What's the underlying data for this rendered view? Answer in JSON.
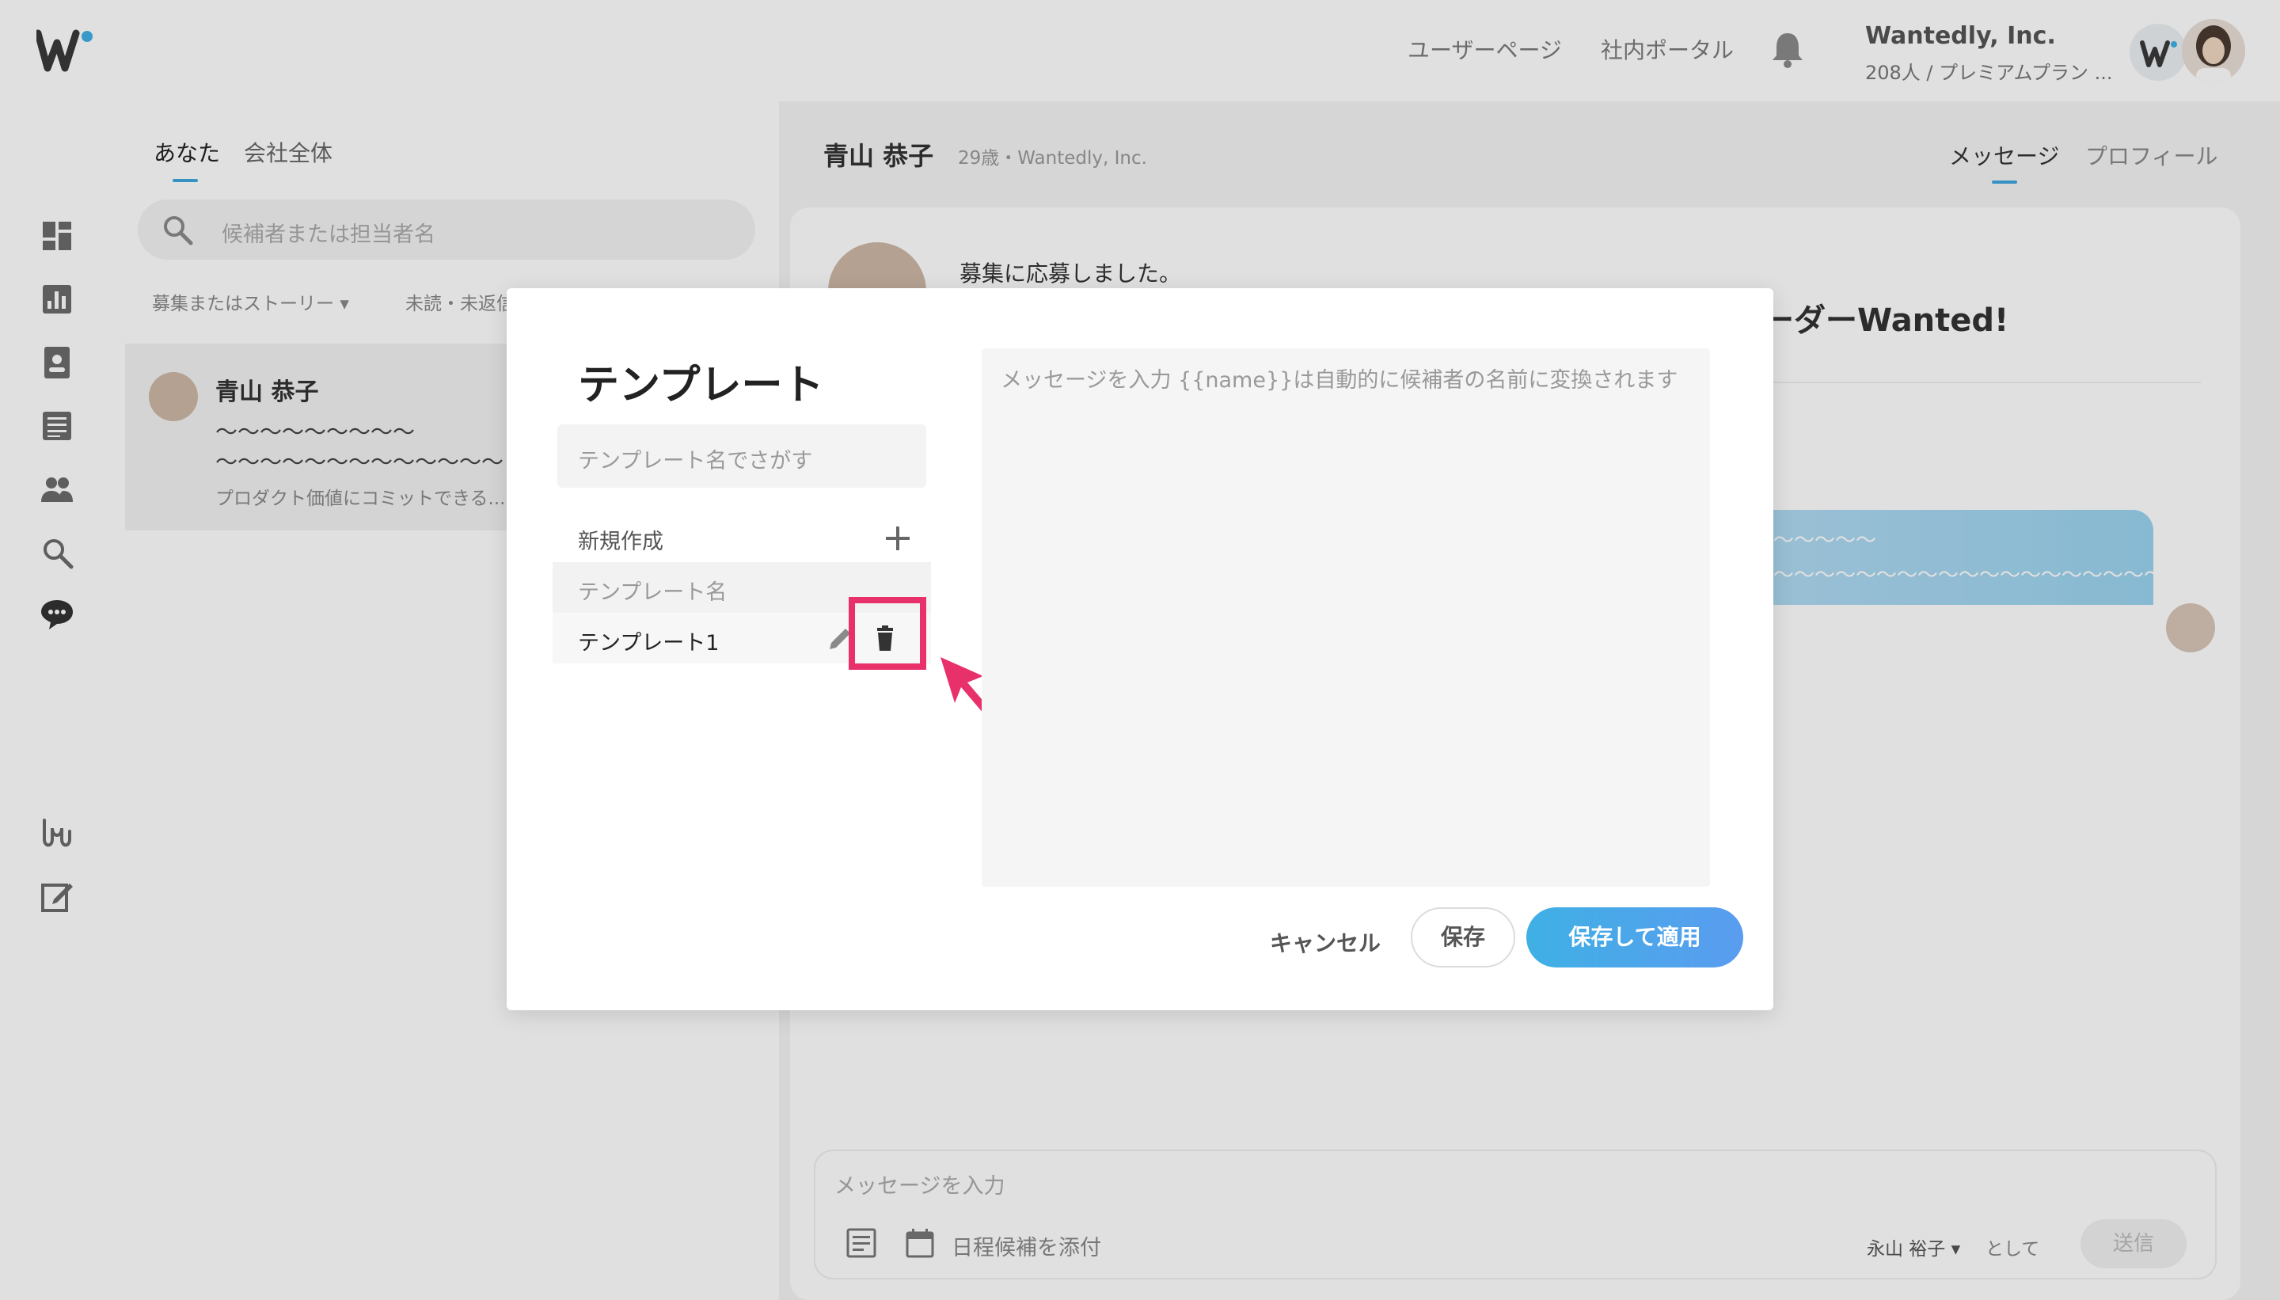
{
  "topbar": {
    "user_page": "ユーザーページ",
    "portal": "社内ポータル",
    "company_name": "Wantedly, Inc.",
    "company_plan": "208人 / プレミアムプラン ..."
  },
  "list": {
    "tabs": [
      "あなた",
      "会社全体"
    ],
    "search_placeholder": "候補者または担当者名",
    "filters": [
      "募集またはストーリー",
      "未読・未返信"
    ],
    "item": {
      "name": "青山 恭子",
      "line1": "〜〜〜〜〜〜〜〜〜",
      "line2": "〜〜〜〜〜〜〜〜〜〜〜〜〜",
      "snippet": "プロダクト価値にコミットできる..."
    }
  },
  "chat": {
    "name": "青山 恭子",
    "meta": "29歳・Wantedly, Inc.",
    "tabs": [
      "メッセージ",
      "プロフィール"
    ],
    "applied": "募集に応募しました。",
    "story_title": "ーダーWanted!",
    "bubble_lines": [
      "〜〜〜〜〜",
      "〜〜〜〜〜〜〜〜〜〜〜〜〜〜〜〜〜〜〜"
    ],
    "composer_placeholder": "メッセージを入力",
    "attach_schedule": "日程候補を添付",
    "sender": "永山 裕子 ▾",
    "as_label": "として",
    "send": "送信"
  },
  "modal": {
    "title": "テンプレート",
    "search_placeholder": "テンプレート名でさがす",
    "new_label": "新規作成",
    "header_label": "テンプレート名",
    "items": [
      "テンプレート1"
    ],
    "message_placeholder": "メッセージを入力  {{name}}は自動的に候補者の名前に変換されます",
    "cancel": "キャンセル",
    "save": "保存",
    "save_apply": "保存して適用"
  },
  "colors": {
    "accent": "#3fa7e0",
    "highlight": "#e8306a"
  }
}
